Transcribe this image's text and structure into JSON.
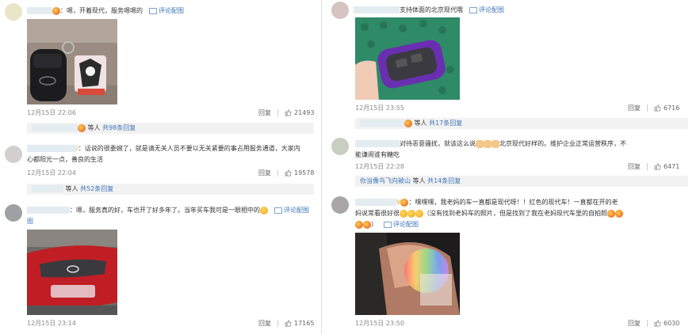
{
  "left": {
    "c1": {
      "text": "：嗯，开着现代，服务嗯嗯的",
      "image_link": "评论配图",
      "time": "12月15日 22:06",
      "reply": "回复",
      "likes": "21493"
    },
    "r1": {
      "pre": "等人",
      "count": "共98条回复"
    },
    "c2": {
      "line1": "：话说的很委婉了，就是请无关人员不要以无关紧要的事占用服务通道，大家内",
      "line2": "心都阳光一点，善良的生活",
      "time": "12月15日 22:04",
      "reply": "回复",
      "likes": "19578"
    },
    "r2": {
      "pre": "等人",
      "count": "共52条回复"
    },
    "c3": {
      "text": "：嗯，服务真的好，车也开了好多年了。当年买车我可是一眼相中的",
      "image_link": "评论配图",
      "image_label": "图",
      "time": "12月15日 23:14",
      "reply": "回复",
      "likes": "17165"
    }
  },
  "right": {
    "c1": {
      "text": "支持体面的北京现代哦",
      "image_link": "评论配图",
      "time": "12月15日 23:55",
      "reply": "回复",
      "likes": "6716"
    },
    "r1": {
      "pre": "等人",
      "count": "共17条回复"
    },
    "c2": {
      "line1a": "对待恶意骚扰，就该这么说",
      "line1b": "北京现代好样的。维护企业正常运营秩序，不",
      "line2": "能谦闹谁有糖吃",
      "time": "12月15日 22:28",
      "reply": "回复",
      "likes": "6471"
    },
    "r2": {
      "user": "你当像鸟飞向被山",
      "pre": "等人",
      "count": "共14条回复"
    },
    "c3": {
      "line1": "：嘿嘿嘿，我老妈的车一直都是现代呀！！红色的现代车！一直都在开的老",
      "line2a": "妈说常看很好很",
      "line2b": "（没有找到老妈车的照片，但是找到了我在老妈现代车里的自拍照",
      "image_link": "评论配图",
      "time": "12月15日 23:50",
      "reply": "回复",
      "likes": "6030"
    }
  },
  "colors": {
    "link": "#3b74b8",
    "meta": "#8a8a8a",
    "reply_bg": "#f2f2f2"
  }
}
